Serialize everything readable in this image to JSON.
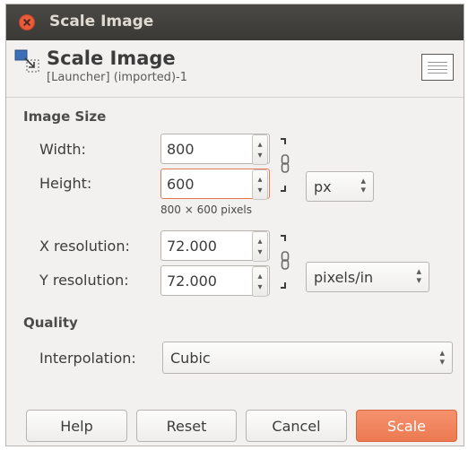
{
  "window": {
    "title": "Scale Image"
  },
  "header": {
    "title": "Scale Image",
    "subtitle": "[Launcher] (imported)-1"
  },
  "image_size": {
    "section_label": "Image Size",
    "width_label": "Width:",
    "width_value": "800",
    "height_label": "Height:",
    "height_value": "600",
    "size_unit": "px",
    "pixel_summary": "800 × 600 pixels",
    "xres_label": "X resolution:",
    "xres_value": "72.000",
    "yres_label": "Y resolution:",
    "yres_value": "72.000",
    "res_unit": "pixels/in"
  },
  "quality": {
    "section_label": "Quality",
    "interpolation_label": "Interpolation:",
    "interpolation_value": "Cubic"
  },
  "buttons": {
    "help": "Help",
    "reset": "Reset",
    "cancel": "Cancel",
    "scale": "Scale"
  },
  "icons": {
    "close": "close-icon",
    "scale": "scale-image-icon",
    "chain": "chain-link-icon",
    "spin": "up-down-arrows-icon",
    "preview": "image-preview-thumbnail"
  },
  "colors": {
    "titlebar": "#3f3e3a",
    "close_button": "#e95c3a",
    "primary_button": "#ef8460",
    "focus_border": "#e47a55",
    "dialog_bg": "#f2f1f0"
  }
}
